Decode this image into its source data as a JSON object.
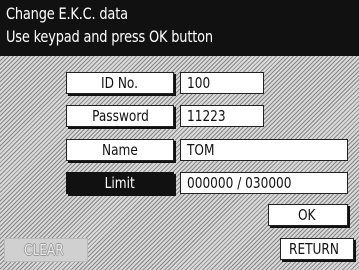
{
  "header": {
    "title": "Change E.K.C. data",
    "instruction": "Use keypad and press OK button"
  },
  "fields": [
    {
      "label": "ID No.",
      "value": "100"
    },
    {
      "label": "Password",
      "value": "11223"
    },
    {
      "label": "Name",
      "value": "TOM"
    },
    {
      "label": "Limit",
      "value": "000000 / 030000"
    }
  ],
  "buttons": {
    "ok": "OK",
    "clear": "CLEAR",
    "return": "RETURN"
  }
}
